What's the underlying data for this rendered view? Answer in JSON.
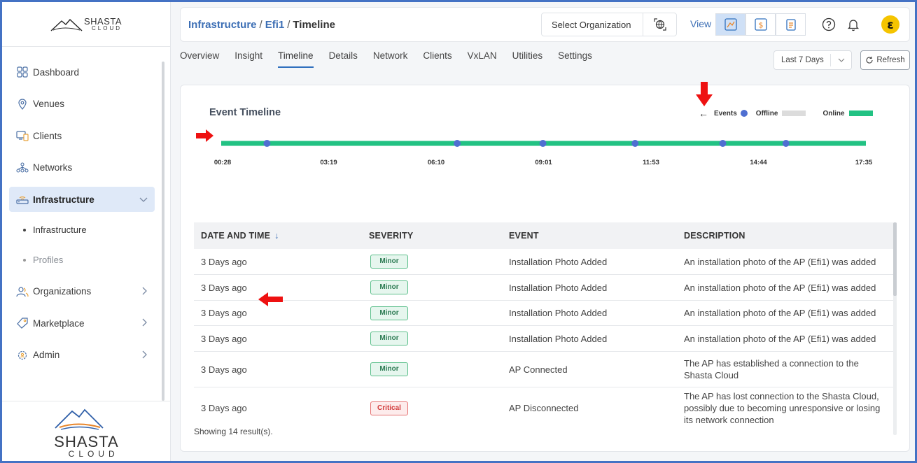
{
  "brand": {
    "word1": "SHASTA",
    "word2": "CLOUD"
  },
  "sidebar": {
    "items": [
      {
        "label": "Dashboard",
        "icon": "grid-icon"
      },
      {
        "label": "Venues",
        "icon": "location-pin-icon"
      },
      {
        "label": "Clients",
        "icon": "devices-icon"
      },
      {
        "label": "Networks",
        "icon": "network-icon"
      },
      {
        "label": "Infrastructure",
        "icon": "router-icon"
      }
    ],
    "sub_items": [
      {
        "label": "Infrastructure"
      },
      {
        "label": "Profiles"
      }
    ],
    "items2": [
      {
        "label": "Organizations",
        "icon": "users-icon"
      },
      {
        "label": "Marketplace",
        "icon": "tag-icon"
      },
      {
        "label": "Admin",
        "icon": "admin-gear-icon"
      }
    ]
  },
  "header": {
    "crumb_1": "Infrastructure",
    "sep_1": "/",
    "crumb_2": "Efi1",
    "sep_2": "/",
    "crumb_3": "Timeline",
    "org_select": "Select Organization",
    "view_label": "View"
  },
  "tabs": [
    "Overview",
    "Insight",
    "Timeline",
    "Details",
    "Network",
    "Clients",
    "VxLAN",
    "Utilities",
    "Settings"
  ],
  "active_tab": "Timeline",
  "range": {
    "value": "Last 7 Days"
  },
  "refresh_label": "Refresh",
  "timeline": {
    "title": "Event Timeline",
    "legend": {
      "events": "Events",
      "offline": "Offline",
      "online": "Online"
    },
    "ticks": [
      "00:28",
      "03:19",
      "06:10",
      "09:01",
      "11:53",
      "14:44",
      "17:35"
    ],
    "event_fractions": [
      0.071,
      0.366,
      0.499,
      0.642,
      0.778,
      0.876
    ],
    "colors": {
      "online": "#22c283",
      "offline": "#dcdcdc",
      "event": "#4f6fd1"
    }
  },
  "table": {
    "headers": {
      "date": "DATE AND TIME",
      "sort": "↓",
      "severity": "SEVERITY",
      "event": "EVENT",
      "description": "DESCRIPTION"
    },
    "rows": [
      {
        "date": "3 Days ago",
        "severity": "Minor",
        "event": "Installation Photo Added",
        "description": "An installation photo of the AP (Efi1) was added"
      },
      {
        "date": "3 Days ago",
        "severity": "Minor",
        "event": "Installation Photo Added",
        "description": "An installation photo of the AP (Efi1) was added"
      },
      {
        "date": "3 Days ago",
        "severity": "Minor",
        "event": "Installation Photo Added",
        "description": "An installation photo of the AP (Efi1) was added"
      },
      {
        "date": "3 Days ago",
        "severity": "Minor",
        "event": "Installation Photo Added",
        "description": "An installation photo of the AP (Efi1) was added"
      },
      {
        "date": "3 Days ago",
        "severity": "Minor",
        "event": "AP Connected",
        "description": "The AP has established a connection to the Shasta Cloud"
      },
      {
        "date": "3 Days ago",
        "severity": "Critical",
        "event": "AP Disconnected",
        "description": "The AP has lost connection to the Shasta Cloud, possibly due to becoming unresponsive or losing its network connection"
      }
    ],
    "showing": "Showing 14 result(s)."
  },
  "annotation_color": "#ee1111"
}
